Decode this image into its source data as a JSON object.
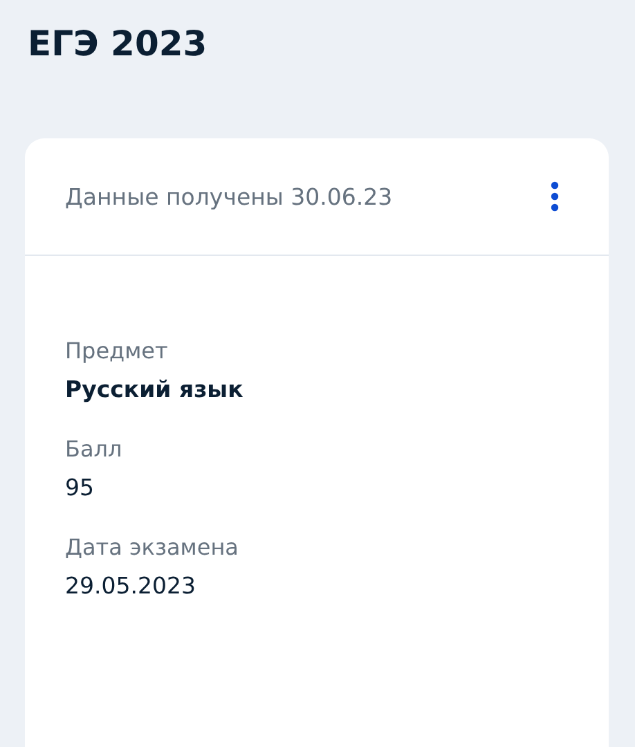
{
  "title": "ЕГЭ 2023",
  "card": {
    "header": "Данные получены 30.06.23",
    "fields": [
      {
        "label": "Предмет",
        "value": "Русский язык",
        "kind": "bold"
      },
      {
        "label": "Балл",
        "value": "95",
        "kind": "plain"
      },
      {
        "label": "Дата экзамена",
        "value": "29.05.2023",
        "kind": "plain"
      }
    ]
  }
}
